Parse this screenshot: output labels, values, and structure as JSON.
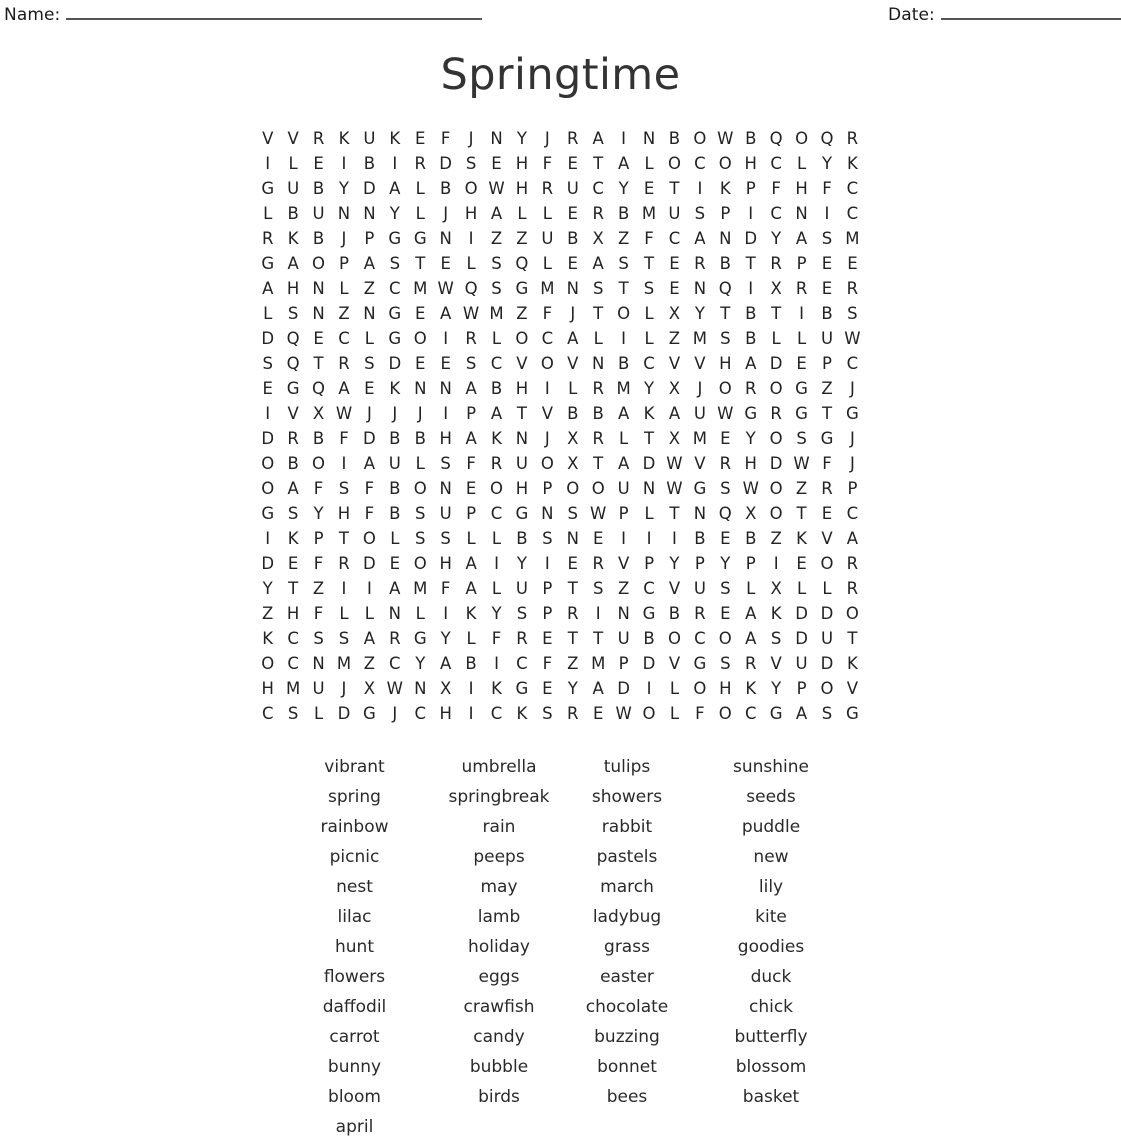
{
  "header": {
    "name_label": "Name:",
    "date_label": "Date:"
  },
  "title": "Springtime",
  "grid": {
    "rows": 24,
    "cols": 24,
    "letters": [
      [
        "V",
        "V",
        "R",
        "K",
        "U",
        "K",
        "E",
        "F",
        "J",
        "N",
        "Y",
        "J",
        "R",
        "A",
        "I",
        "N",
        "B",
        "O",
        "W",
        "B",
        "Q",
        "O",
        "Q",
        "R"
      ],
      [
        "I",
        "L",
        "E",
        "I",
        "B",
        "I",
        "R",
        "D",
        "S",
        "E",
        "H",
        "F",
        "E",
        "T",
        "A",
        "L",
        "O",
        "C",
        "O",
        "H",
        "C",
        "L",
        "Y",
        "K"
      ],
      [
        "G",
        "U",
        "B",
        "Y",
        "D",
        "A",
        "L",
        "B",
        "O",
        "W",
        "H",
        "R",
        "U",
        "C",
        "Y",
        "E",
        "T",
        "I",
        "K",
        "P",
        "F",
        "H",
        "F",
        "C"
      ],
      [
        "L",
        "B",
        "U",
        "N",
        "N",
        "Y",
        "L",
        "J",
        "H",
        "A",
        "L",
        "L",
        "E",
        "R",
        "B",
        "M",
        "U",
        "S",
        "P",
        "I",
        "C",
        "N",
        "I",
        "C"
      ],
      [
        "R",
        "K",
        "B",
        "J",
        "P",
        "G",
        "G",
        "N",
        "I",
        "Z",
        "Z",
        "U",
        "B",
        "X",
        "Z",
        "F",
        "C",
        "A",
        "N",
        "D",
        "Y",
        "A",
        "S",
        "M"
      ],
      [
        "G",
        "A",
        "O",
        "P",
        "A",
        "S",
        "T",
        "E",
        "L",
        "S",
        "Q",
        "L",
        "E",
        "A",
        "S",
        "T",
        "E",
        "R",
        "B",
        "T",
        "R",
        "P",
        "E",
        "E"
      ],
      [
        "A",
        "H",
        "N",
        "L",
        "Z",
        "C",
        "M",
        "W",
        "Q",
        "S",
        "G",
        "M",
        "N",
        "S",
        "T",
        "S",
        "E",
        "N",
        "Q",
        "I",
        "X",
        "R",
        "E",
        "R"
      ],
      [
        "L",
        "S",
        "N",
        "Z",
        "N",
        "G",
        "E",
        "A",
        "W",
        "M",
        "Z",
        "F",
        "J",
        "T",
        "O",
        "L",
        "X",
        "Y",
        "T",
        "B",
        "T",
        "I",
        "B",
        "S"
      ],
      [
        "D",
        "Q",
        "E",
        "C",
        "L",
        "G",
        "O",
        "I",
        "R",
        "L",
        "O",
        "C",
        "A",
        "L",
        "I",
        "L",
        "Z",
        "M",
        "S",
        "B",
        "L",
        "L",
        "U",
        "W"
      ],
      [
        "S",
        "Q",
        "T",
        "R",
        "S",
        "D",
        "E",
        "E",
        "S",
        "C",
        "V",
        "O",
        "V",
        "N",
        "B",
        "C",
        "V",
        "V",
        "H",
        "A",
        "D",
        "E",
        "P",
        "C"
      ],
      [
        "E",
        "G",
        "Q",
        "A",
        "E",
        "K",
        "N",
        "N",
        "A",
        "B",
        "H",
        "I",
        "L",
        "R",
        "M",
        "Y",
        "X",
        "J",
        "O",
        "R",
        "O",
        "G",
        "Z",
        "J"
      ],
      [
        "I",
        "V",
        "X",
        "W",
        "J",
        "J",
        "J",
        "I",
        "P",
        "A",
        "T",
        "V",
        "B",
        "B",
        "A",
        "K",
        "A",
        "U",
        "W",
        "G",
        "R",
        "G",
        "T",
        "G"
      ],
      [
        "D",
        "R",
        "B",
        "F",
        "D",
        "B",
        "B",
        "H",
        "A",
        "K",
        "N",
        "J",
        "X",
        "R",
        "L",
        "T",
        "X",
        "M",
        "E",
        "Y",
        "O",
        "S",
        "G",
        "J"
      ],
      [
        "O",
        "B",
        "O",
        "I",
        "A",
        "U",
        "L",
        "S",
        "F",
        "R",
        "U",
        "O",
        "X",
        "T",
        "A",
        "D",
        "W",
        "V",
        "R",
        "H",
        "D",
        "W",
        "F",
        "J"
      ],
      [
        "O",
        "A",
        "F",
        "S",
        "F",
        "B",
        "O",
        "N",
        "E",
        "O",
        "H",
        "P",
        "O",
        "O",
        "U",
        "N",
        "W",
        "G",
        "S",
        "W",
        "O",
        "Z",
        "R",
        "P"
      ],
      [
        "G",
        "S",
        "Y",
        "H",
        "F",
        "B",
        "S",
        "U",
        "P",
        "C",
        "G",
        "N",
        "S",
        "W",
        "P",
        "L",
        "T",
        "N",
        "Q",
        "X",
        "O",
        "T",
        "E",
        "C"
      ],
      [
        "I",
        "K",
        "P",
        "T",
        "O",
        "L",
        "S",
        "S",
        "L",
        "L",
        "B",
        "S",
        "N",
        "E",
        "I",
        "I",
        "I",
        "B",
        "E",
        "B",
        "Z",
        "K",
        "V",
        "A"
      ],
      [
        "D",
        "E",
        "F",
        "R",
        "D",
        "E",
        "O",
        "H",
        "A",
        "I",
        "Y",
        "I",
        "E",
        "R",
        "V",
        "P",
        "Y",
        "P",
        "Y",
        "P",
        "I",
        "E",
        "O",
        "R"
      ],
      [
        "Y",
        "T",
        "Z",
        "I",
        "I",
        "A",
        "M",
        "F",
        "A",
        "L",
        "U",
        "P",
        "T",
        "S",
        "Z",
        "C",
        "V",
        "U",
        "S",
        "L",
        "X",
        "L",
        "L",
        "R"
      ],
      [
        "Z",
        "H",
        "F",
        "L",
        "L",
        "N",
        "L",
        "I",
        "K",
        "Y",
        "S",
        "P",
        "R",
        "I",
        "N",
        "G",
        "B",
        "R",
        "E",
        "A",
        "K",
        "D",
        "D",
        "O"
      ],
      [
        "K",
        "C",
        "S",
        "S",
        "A",
        "R",
        "G",
        "Y",
        "L",
        "F",
        "R",
        "E",
        "T",
        "T",
        "U",
        "B",
        "O",
        "C",
        "O",
        "A",
        "S",
        "D",
        "U",
        "T"
      ],
      [
        "O",
        "C",
        "N",
        "M",
        "Z",
        "C",
        "Y",
        "A",
        "B",
        "I",
        "C",
        "F",
        "Z",
        "M",
        "P",
        "D",
        "V",
        "G",
        "S",
        "R",
        "V",
        "U",
        "D",
        "K"
      ],
      [
        "H",
        "M",
        "U",
        "J",
        "X",
        "W",
        "N",
        "X",
        "I",
        "K",
        "G",
        "E",
        "Y",
        "A",
        "D",
        "I",
        "L",
        "O",
        "H",
        "K",
        "Y",
        "P",
        "O",
        "V"
      ],
      [
        "C",
        "S",
        "L",
        "D",
        "G",
        "J",
        "C",
        "H",
        "I",
        "C",
        "K",
        "S",
        "R",
        "E",
        "W",
        "O",
        "L",
        "F",
        "O",
        "C",
        "G",
        "A",
        "S",
        "G"
      ]
    ]
  },
  "word_list": {
    "rows": [
      [
        "vibrant",
        "umbrella",
        "tulips",
        "sunshine"
      ],
      [
        "spring",
        "springbreak",
        "showers",
        "seeds"
      ],
      [
        "rainbow",
        "rain",
        "rabbit",
        "puddle"
      ],
      [
        "picnic",
        "peeps",
        "pastels",
        "new"
      ],
      [
        "nest",
        "may",
        "march",
        "lily"
      ],
      [
        "lilac",
        "lamb",
        "ladybug",
        "kite"
      ],
      [
        "hunt",
        "holiday",
        "grass",
        "goodies"
      ],
      [
        "flowers",
        "eggs",
        "easter",
        "duck"
      ],
      [
        "daffodil",
        "crawfish",
        "chocolate",
        "chick"
      ],
      [
        "carrot",
        "candy",
        "buzzing",
        "butterfly"
      ],
      [
        "bunny",
        "bubble",
        "bonnet",
        "blossom"
      ],
      [
        "bloom",
        "birds",
        "bees",
        "basket"
      ],
      [
        "april",
        "",
        "",
        ""
      ]
    ]
  },
  "colors": {
    "text": "#2b2b2b",
    "rule": "#555555",
    "background": "#ffffff"
  }
}
